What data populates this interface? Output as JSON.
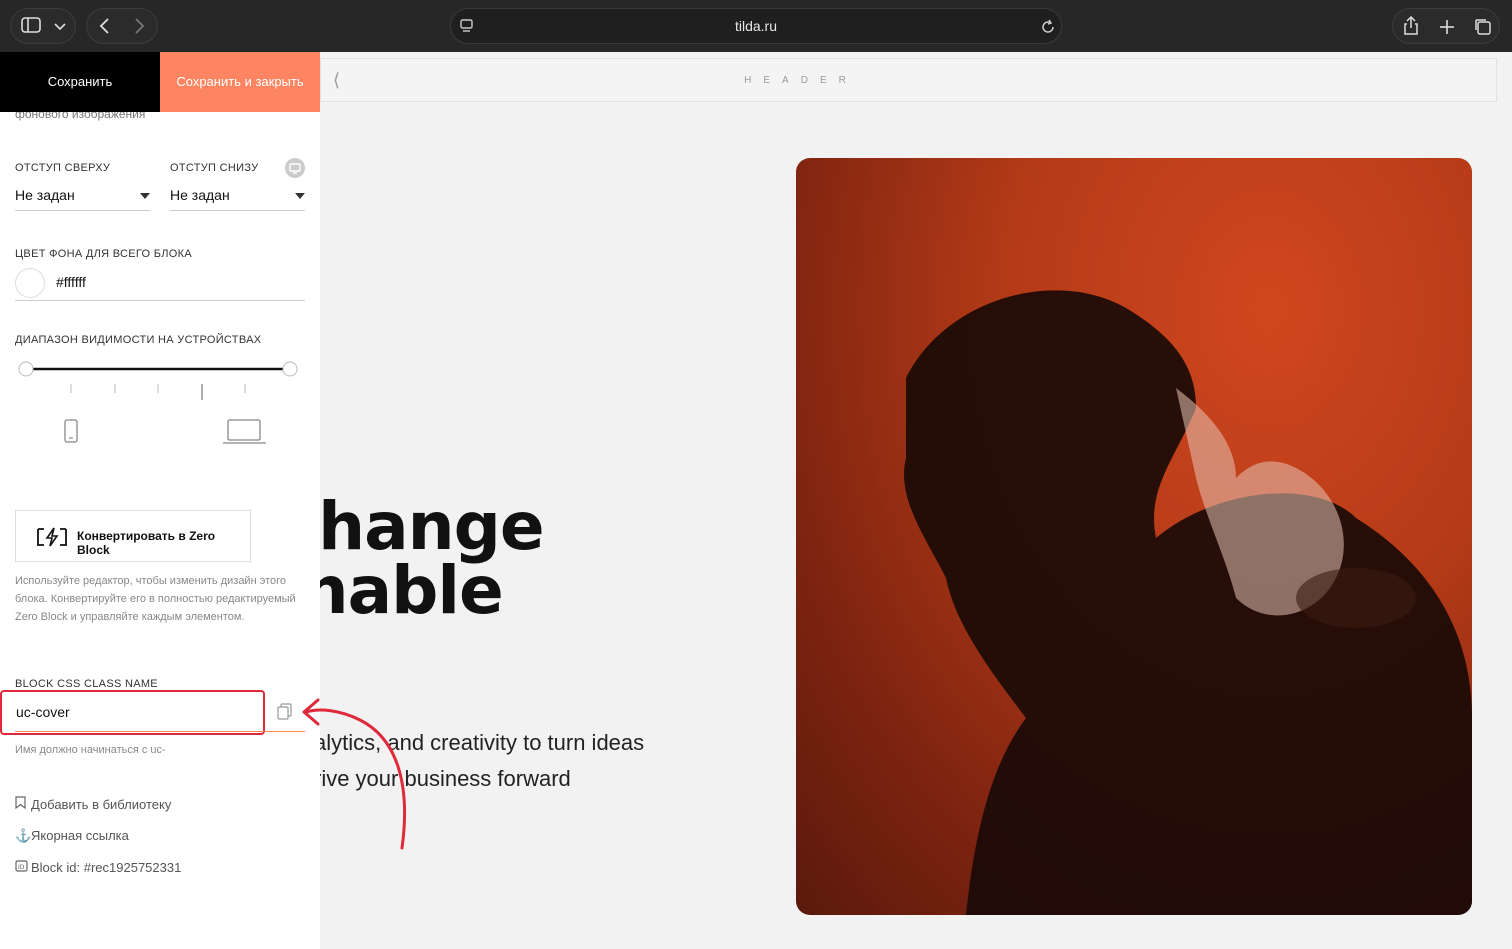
{
  "browser": {
    "url": "tilda.ru"
  },
  "page": {
    "header_label": "HEADER",
    "headline_line1": "change",
    "headline_line2": "inable",
    "subline1": "alytics, and creativity to turn ideas",
    "subline2": "rive your business forward"
  },
  "sidebar": {
    "save_label": "Сохранить",
    "save_close_label": "Сохранить и закрыть",
    "cut_label": "фонового изображения",
    "padding_top_label": "ОТСТУП СВЕРХУ",
    "padding_top_value": "Не задан",
    "padding_bottom_label": "ОТСТУП СНИЗУ",
    "padding_bottom_value": "Не задан",
    "bg_color_label": "ЦВЕТ ФОНА ДЛЯ ВСЕГО БЛОКА",
    "bg_color_value": "#ffffff",
    "visibility_label": "ДИАПАЗОН ВИДИМОСТИ НА УСТРОЙСТВАХ",
    "zero_block_label": "Конвертировать в Zero Block",
    "zero_help_1": "Используйте редактор, чтобы изменить дизайн этого",
    "zero_help_2": "блока. Конвертируйте его в полностью редактируемый",
    "zero_help_3": "Zero Block и управляйте каждым элементом.",
    "css_class_label": "BLOCK CSS CLASS NAME",
    "css_class_value": "uc-cover",
    "css_class_hint": "Имя должно начинаться с uc-",
    "add_library": "Добавить в библиотеку",
    "anchor_link": "Якорная ссылка",
    "block_id": "Block id:  #rec1925752331"
  },
  "colors": {
    "accent": "#ff8562",
    "highlight": "#e0293a"
  }
}
